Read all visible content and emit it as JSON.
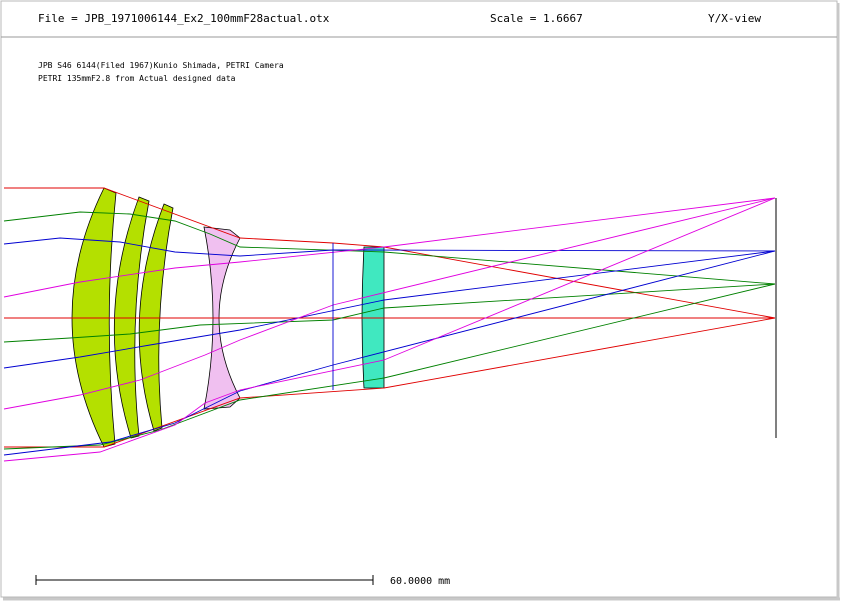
{
  "header": {
    "file": "File = JPB_1971006144_Ex2_100mmF28actual.otx",
    "scale": "Scale = 1.6667",
    "view": "Y/X-view"
  },
  "notes": [
    "JPB S46 6144(Filed 1967)Kunio Shimada, PETRI Camera",
    "PETRI 135mmF2.8 from Actual designed data"
  ],
  "scale_bar": {
    "label": "60.0000 mm"
  },
  "colors": {
    "axis_ray": "#e00000",
    "ray_green": "#008000",
    "ray_blue": "#0000d0",
    "ray_magenta": "#e000e0",
    "element_yellow": "#b4e000",
    "element_pink": "#f0c0f0",
    "element_cyan": "#40e8c0",
    "frame": "#b8b8b8"
  }
}
